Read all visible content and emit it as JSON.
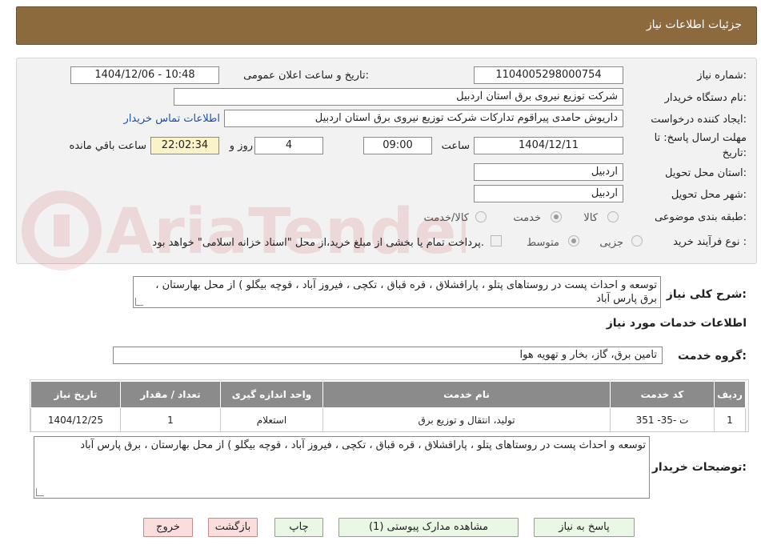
{
  "header": {
    "title": "جزئیات اطلاعات نیاز"
  },
  "form": {
    "need_number_label": "شماره نیاز:",
    "need_number": "1104005298000754",
    "announce_label": "تاریخ و ساعت اعلان عمومی:",
    "announce_value": "1404/12/06 - 10:48",
    "buyer_org_label": "نام دستگاه خریدار:",
    "buyer_org": "شرکت توزیع نیروی برق استان اردبیل",
    "requester_label": "ایجاد کننده درخواست:",
    "requester": "داریوش حامدی پیراقوم تدارکات شرکت توزیع نیروی برق استان اردبیل",
    "contact_link": "اطلاعات تماس خریدار",
    "deadline_label_1": "مهلت ارسال پاسخ: تا",
    "deadline_label_2": "تاریخ:",
    "deadline_date": "1404/12/11",
    "hour_label": "ساعت",
    "deadline_time": "09:00",
    "days_value": "4",
    "days_label": "روز و",
    "remaining_time": "22:02:34",
    "remaining_label": "ساعت باقي مانده",
    "province_label": "استان محل تحویل:",
    "province": "اردبیل",
    "city_label": "شهر محل تحویل:",
    "city": "اردبیل",
    "category_label": "طبقه بندی موضوعی:",
    "category_options": [
      "کالا",
      "خدمت",
      "کالا/خدمت"
    ],
    "category_selected": "خدمت",
    "process_label": "نوع فرآیند خرید :",
    "process_options": [
      "جزیی",
      "متوسط"
    ],
    "process_selected": "متوسط",
    "payment_note": "پرداخت تمام یا بخشی از مبلغ خرید،از محل \"اسناد خزانه اسلامی\" خواهد بود."
  },
  "description": {
    "label": "شرح کلی نیاز:",
    "text": "توسعه و احداث پست در روستاهای پتلو ، پاراقشلاق ، قره قباق ، تکچی ، فیروز آباد ، قوچه بیگلو ) از محل بهارستان ، برق پارس آباد"
  },
  "services": {
    "section_title": "اطلاعات خدمات مورد نیاز",
    "group_label": "گروه خدمت:",
    "group_value": "تامین برق، گاز، بخار و تهویه هوا",
    "columns": [
      "ردیف",
      "کد خدمت",
      "نام خدمت",
      "واحد اندازه گیری",
      "تعداد / مقدار",
      "تاریخ نیاز"
    ],
    "rows": [
      [
        "1",
        "ت -35- 351",
        "تولید، انتقال و توزیع برق",
        "استعلام",
        "1",
        "1404/12/25"
      ]
    ]
  },
  "buyer_notes": {
    "label": "توضیحات خریدار:",
    "text": "توسعه و احداث پست در روستاهای پتلو ، پاراقشلاق ، قره قباق ، تکچی ، فیروز آباد ، قوچه بیگلو ) از محل بهارستان ، برق پارس آباد"
  },
  "buttons": {
    "reply": "پاسخ به نیاز",
    "attachments": "مشاهده مدارک پیوستی (1)",
    "print": "چاپ",
    "back": "بازگشت",
    "exit": "خروج"
  },
  "watermark": {
    "text": "AriaTender.neT"
  },
  "colors": {
    "header_bg": "#8c6a3d",
    "table_header_bg": "#8b8b8b",
    "button_bg": "#e9f7e4",
    "button_red_bg": "#fadede",
    "link": "#1a4fb0"
  }
}
